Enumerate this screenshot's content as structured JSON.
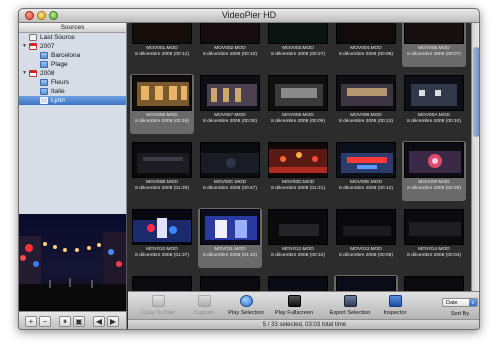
{
  "window": {
    "title": "VideoPier HD"
  },
  "sidebar": {
    "header": "Sources",
    "items": [
      {
        "label": "Last Source",
        "level": 0,
        "icon": "recent-icon",
        "triangle": ""
      },
      {
        "label": "2007",
        "level": 0,
        "icon": "calendar-icon",
        "triangle": "▼"
      },
      {
        "label": "Barcelona",
        "level": 1,
        "icon": "folder-icon",
        "triangle": ""
      },
      {
        "label": "Plage",
        "level": 1,
        "icon": "folder-icon",
        "triangle": ""
      },
      {
        "label": "2008",
        "level": 0,
        "icon": "calendar-icon",
        "triangle": "▼"
      },
      {
        "label": "Fleurs",
        "level": 1,
        "icon": "folder-icon",
        "triangle": ""
      },
      {
        "label": "Italie",
        "level": 1,
        "icon": "folder-icon",
        "triangle": ""
      },
      {
        "label": "Lyon",
        "level": 1,
        "icon": "folder-icon",
        "triangle": "",
        "selected": true
      }
    ]
  },
  "bottom_buttons": [
    "+",
    "−",
    "⏸",
    "▣",
    "◀",
    "▶"
  ],
  "clips": [
    {
      "name": "MOV001.MOD",
      "date": "8 décembre 2008 (00:12)",
      "selected": false,
      "scene": "a"
    },
    {
      "name": "MOV002.MOD",
      "date": "8 décembre 2008 (00:10)",
      "selected": false,
      "scene": "b"
    },
    {
      "name": "MOV003.MOD",
      "date": "8 décembre 2008 (00:27)",
      "selected": false,
      "scene": "c"
    },
    {
      "name": "MOV004.MOD",
      "date": "8 décembre 2008 (00:09)",
      "selected": false,
      "scene": "d"
    },
    {
      "name": "MOV005.MOD",
      "date": "8 décembre 2008 (00:07)",
      "selected": true,
      "scene": "e"
    },
    {
      "name": "MOV006.MOD",
      "date": "8 décembre 2008 (00:18)",
      "selected": true,
      "scene": "f"
    },
    {
      "name": "MOV007.MOD",
      "date": "8 décembre 2008 (00:30)",
      "selected": false,
      "scene": "g"
    },
    {
      "name": "MOV008.MOD",
      "date": "8 décembre 2008 (00:09)",
      "selected": false,
      "scene": "h"
    },
    {
      "name": "MOV009.MOD",
      "date": "8 décembre 2008 (00:13)",
      "selected": false,
      "scene": "i"
    },
    {
      "name": "MOV00A.MOD",
      "date": "8 décembre 2008 (00:10)",
      "selected": false,
      "scene": "j"
    },
    {
      "name": "MOV00B.MOD",
      "date": "8 décembre 2008 (01:29)",
      "selected": false,
      "scene": "k"
    },
    {
      "name": "MOV00C.MOD",
      "date": "8 décembre 2008 (00:47)",
      "selected": false,
      "scene": "l"
    },
    {
      "name": "MOV00D.MOD",
      "date": "8 décembre 2008 (01:21)",
      "selected": false,
      "scene": "m"
    },
    {
      "name": "MOV00E.MOD",
      "date": "8 décembre 2008 (00:12)",
      "selected": false,
      "scene": "n"
    },
    {
      "name": "MOV00F.MOD",
      "date": "8 décembre 2008 (00:29)",
      "selected": true,
      "scene": "o"
    },
    {
      "name": "MOV010.MOD",
      "date": "8 décembre 2008 (01:37)",
      "selected": false,
      "scene": "p"
    },
    {
      "name": "MOV011.MOD",
      "date": "8 décembre 2008 (01:10)",
      "selected": true,
      "scene": "q"
    },
    {
      "name": "MOV012.MOD",
      "date": "8 décembre 2008 (00:10)",
      "selected": false,
      "scene": "r"
    },
    {
      "name": "MOV013.MOD",
      "date": "8 décembre 2008 (00:09)",
      "selected": false,
      "scene": "s"
    },
    {
      "name": "MOV014.MOD",
      "date": "8 décembre 2008 (00:04)",
      "selected": false,
      "scene": "t"
    },
    {
      "name": "",
      "date": "",
      "selected": false,
      "scene": "u"
    },
    {
      "name": "",
      "date": "",
      "selected": false,
      "scene": "v"
    },
    {
      "name": "",
      "date": "",
      "selected": false,
      "scene": "w"
    },
    {
      "name": "",
      "date": "",
      "selected": true,
      "scene": "x"
    },
    {
      "name": "",
      "date": "",
      "selected": false,
      "scene": "y"
    }
  ],
  "toolbar": {
    "copy_to_disk": "Copy To Disk",
    "capture": "Capture",
    "play_selection": "Play Selection",
    "play_fullscreen": "Play Fullscreen",
    "export_selection": "Export Selection",
    "inspector": "Inspector",
    "sort_value": "Date",
    "sort_label": "Sort By"
  },
  "status": "5 / 33 selected, 03:03 total time",
  "colors": {
    "window_bg": "#2b2b2b",
    "selection_blue": "#3d74c8",
    "selected_cell": "#6a6a6a"
  }
}
